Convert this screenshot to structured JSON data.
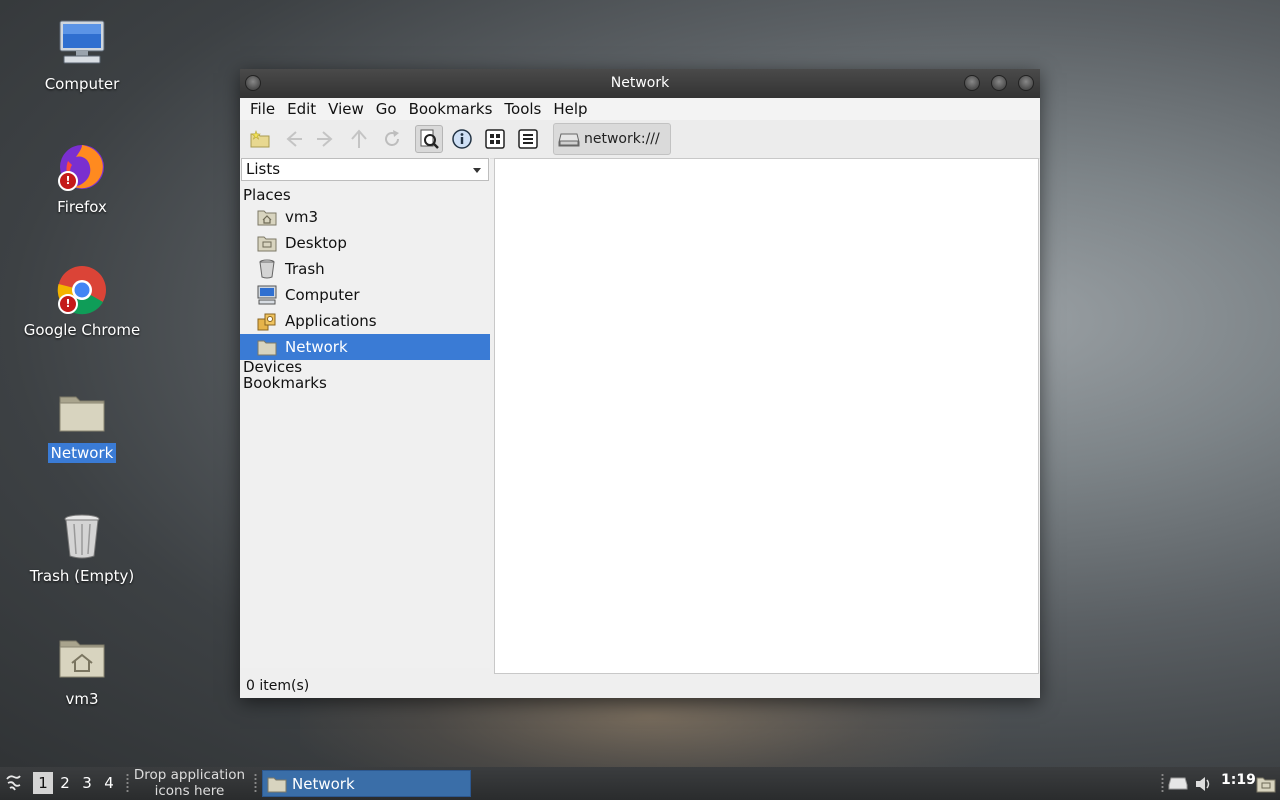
{
  "desktop": {
    "icons": [
      {
        "label": "Computer"
      },
      {
        "label": "Firefox"
      },
      {
        "label": "Google Chrome"
      },
      {
        "label": "Network"
      },
      {
        "label": "Trash (Empty)"
      },
      {
        "label": "vm3"
      }
    ]
  },
  "window": {
    "title": "Network",
    "menu": [
      "File",
      "Edit",
      "View",
      "Go",
      "Bookmarks",
      "Tools",
      "Help"
    ],
    "path": "network:///",
    "side": {
      "combo": "Lists",
      "places_header": "Places",
      "places": [
        {
          "label": "vm3",
          "icon": "home-folder-icon"
        },
        {
          "label": "Desktop",
          "icon": "desktop-folder-icon"
        },
        {
          "label": "Trash",
          "icon": "trash-icon"
        },
        {
          "label": "Computer",
          "icon": "computer-icon"
        },
        {
          "label": "Applications",
          "icon": "applications-icon"
        },
        {
          "label": "Network",
          "icon": "network-folder-icon"
        }
      ],
      "devices_header": "Devices",
      "bookmarks_header": "Bookmarks"
    },
    "status": "0 item(s)"
  },
  "taskbar": {
    "workspaces": [
      "1",
      "2",
      "3",
      "4"
    ],
    "drop_hint_line1": "Drop application",
    "drop_hint_line2": "icons here",
    "task": "Network",
    "clock": "1:19"
  },
  "colors": {
    "selection": "#3a7bd5",
    "taskbar": "#2a2c2d"
  }
}
